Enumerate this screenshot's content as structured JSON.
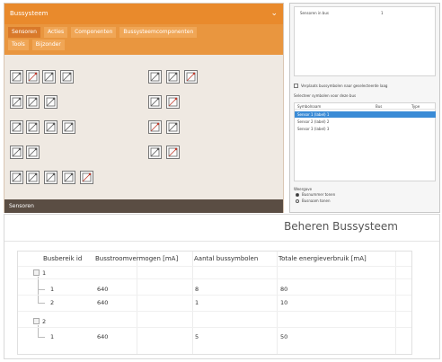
{
  "panel": {
    "title": "Bussysteem",
    "chevron": "⌄",
    "tabs_row1": [
      {
        "label": "Sensoren",
        "active": true
      },
      {
        "label": "Acties",
        "active": false
      },
      {
        "label": "Componenten",
        "active": false
      },
      {
        "label": "Bussysteemcomponenten",
        "active": false
      }
    ],
    "tabs_row2": [
      {
        "label": "Tools",
        "active": false
      },
      {
        "label": "Bijzonder",
        "active": false
      }
    ],
    "status_label": "Sensoren"
  },
  "side_window": {
    "tree_item": "Sensoren in bus",
    "tree_value": "1",
    "checkbox_label": "Verplaats bussymbolen naar geselecteerde laag",
    "list_label": "Selecteer symbolen voor deze bus",
    "list_headers": [
      "Symbolnaam",
      "Bus",
      "Type"
    ],
    "list_rows": [
      {
        "text": "Sensor 1 (label) 1",
        "selected": true
      },
      {
        "text": "Sensor 2 (label) 2",
        "selected": false
      },
      {
        "text": "Sensor 3 (label) 3",
        "selected": false
      }
    ],
    "radio_title": "Weergave",
    "radio_options": [
      "Busnummer tonen",
      "Busnaam tonen"
    ]
  },
  "bottom_window": {
    "title": "Beheren Bussysteem",
    "columns": [
      "Busbereik id",
      "Busstroomvermogen [mA]",
      "Aantal bussymbolen",
      "Totale energieverbruik [mA]"
    ],
    "groups": [
      {
        "id": "1",
        "rows": [
          {
            "id": "1",
            "capacity": "640",
            "count": "8",
            "total": "80"
          },
          {
            "id": "2",
            "capacity": "640",
            "count": "1",
            "total": "10"
          }
        ]
      },
      {
        "id": "2",
        "rows": [
          {
            "id": "1",
            "capacity": "640",
            "count": "5",
            "total": "50"
          }
        ]
      }
    ]
  },
  "colors": {
    "title_orange": "#e98a2c",
    "tab_orange": "#f0a656",
    "status_brown": "#5a4d43",
    "symbol_accent_red": "#c0392b",
    "selection_blue": "#3a8bd6"
  }
}
